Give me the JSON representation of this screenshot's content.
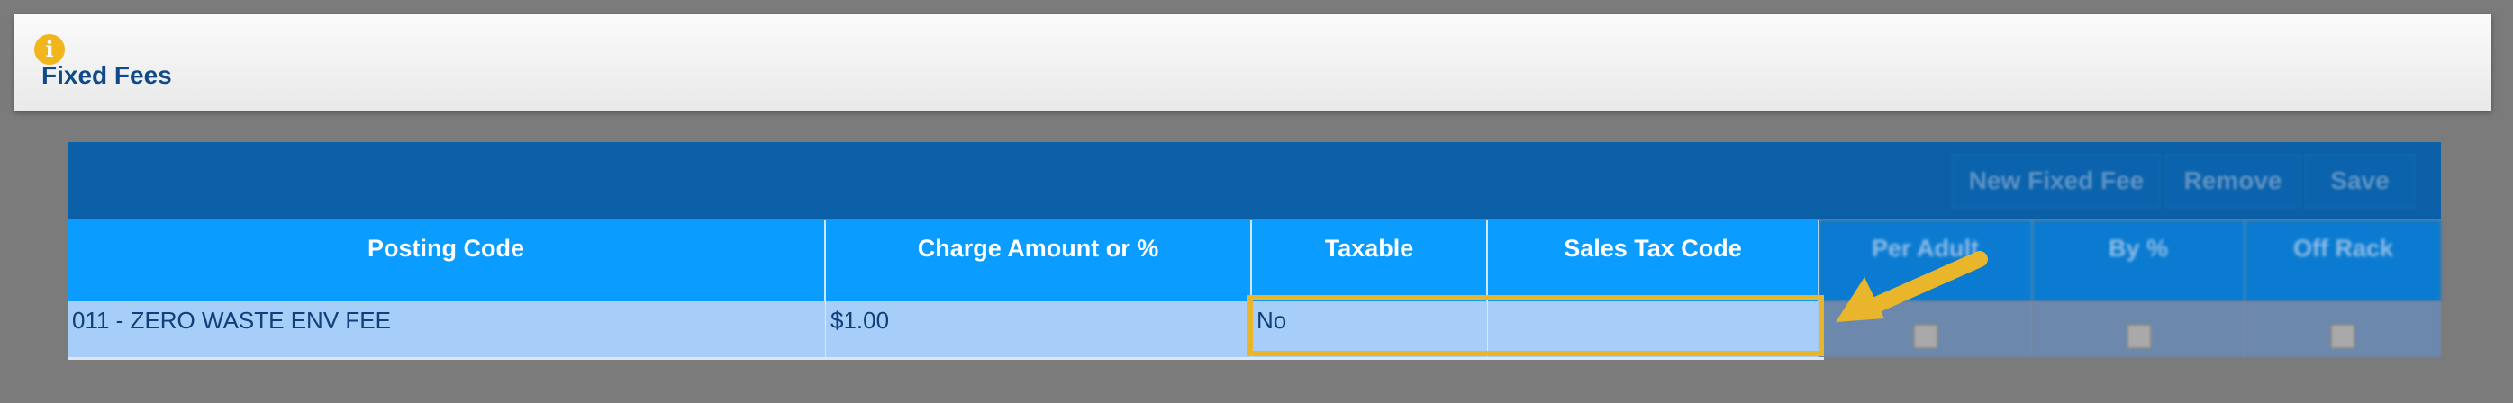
{
  "header": {
    "title": "Fixed Fees",
    "icon": "info-icon"
  },
  "toolbar": {
    "buttons": [
      "New Fixed Fee",
      "Remove",
      "Save"
    ]
  },
  "table": {
    "columns": [
      "Posting Code",
      "Charge Amount or %",
      "Taxable",
      "Sales Tax Code",
      "Per Adult",
      "By %",
      "Off Rack"
    ],
    "rows": [
      {
        "posting_code": "011 - ZERO WASTE ENV FEE",
        "charge": "$1.00",
        "taxable": "No",
        "sales_tax_code": ""
      }
    ]
  },
  "colors": {
    "accent": "#0a9cff",
    "highlight": "#e9b52a",
    "row": "#a7cdf9"
  }
}
